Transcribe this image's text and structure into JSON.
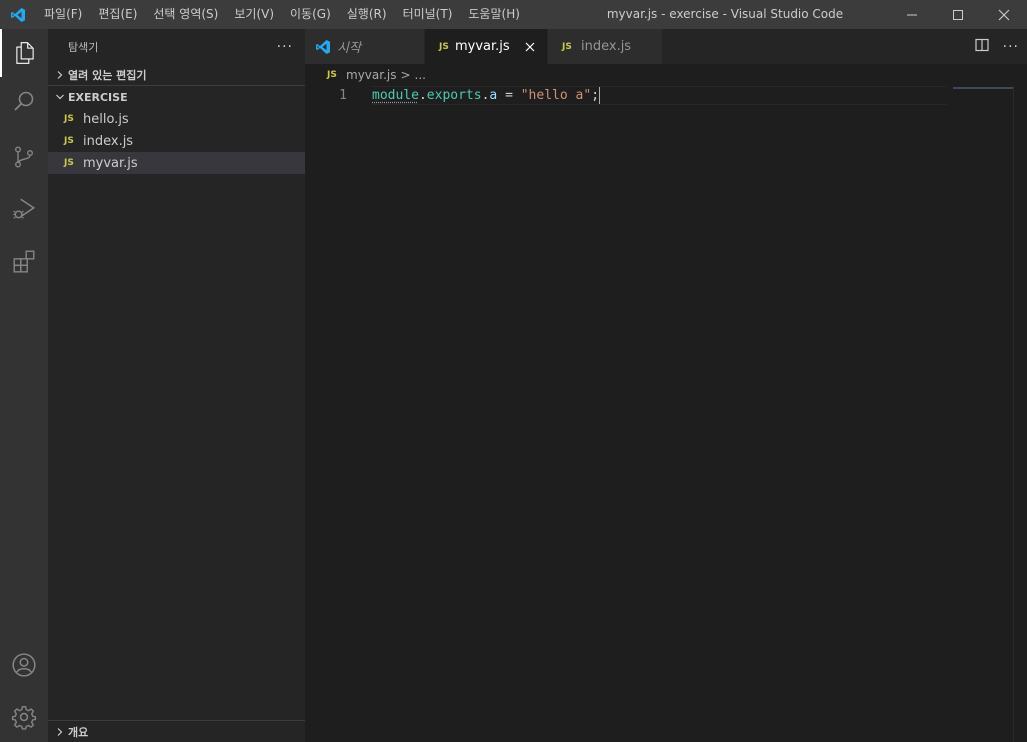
{
  "window": {
    "title": "myvar.js - exercise - Visual Studio Code",
    "logo_icon": "vscode-logo-icon",
    "menu": [
      "파일(F)",
      "편집(E)",
      "선택 영역(S)",
      "보기(V)",
      "이동(G)",
      "실행(R)",
      "터미널(T)",
      "도움말(H)"
    ],
    "controls": [
      "minimize-icon",
      "maximize-icon",
      "close-icon"
    ]
  },
  "activity_bar": {
    "items": [
      "explorer-icon",
      "search-icon",
      "source-control-icon",
      "run-debug-icon",
      "extensions-icon"
    ],
    "bottom_items": [
      "account-icon",
      "settings-gear-icon"
    ]
  },
  "sidebar": {
    "title": "탐색기",
    "more": "···",
    "open_editors_label": "열려 있는 편집기",
    "folder_label": "EXERCISE",
    "files": [
      {
        "badge": "JS",
        "name": "hello.js"
      },
      {
        "badge": "JS",
        "name": "index.js"
      },
      {
        "badge": "JS",
        "name": "myvar.js"
      }
    ],
    "outline_label": "개요"
  },
  "editor": {
    "tabs": [
      {
        "label": "시작",
        "icon": "vscode-logo-icon"
      },
      {
        "label": "myvar.js",
        "badge": "JS",
        "active": true
      },
      {
        "label": "index.js",
        "badge": "JS"
      }
    ],
    "tab_actions": [
      "split-editor-icon",
      "more-actions-icon"
    ],
    "more": "···",
    "breadcrumb": {
      "badge": "JS",
      "file": "myvar.js",
      "sep": ">",
      "rest": "..."
    },
    "lines": [
      {
        "number": "1",
        "tokens": {
          "t1": "module",
          "t2": ".",
          "t3": "exports",
          "t4": ".",
          "t5": "a",
          "t6": " = ",
          "t7": "\"hello a\"",
          "t8": ";"
        }
      }
    ]
  },
  "colors": {
    "accent_blue": "#23a9f2",
    "js_badge": "#cbcb41",
    "string": "#ce9178",
    "variable": "#4ec9b0",
    "property": "#9cdcfe"
  }
}
